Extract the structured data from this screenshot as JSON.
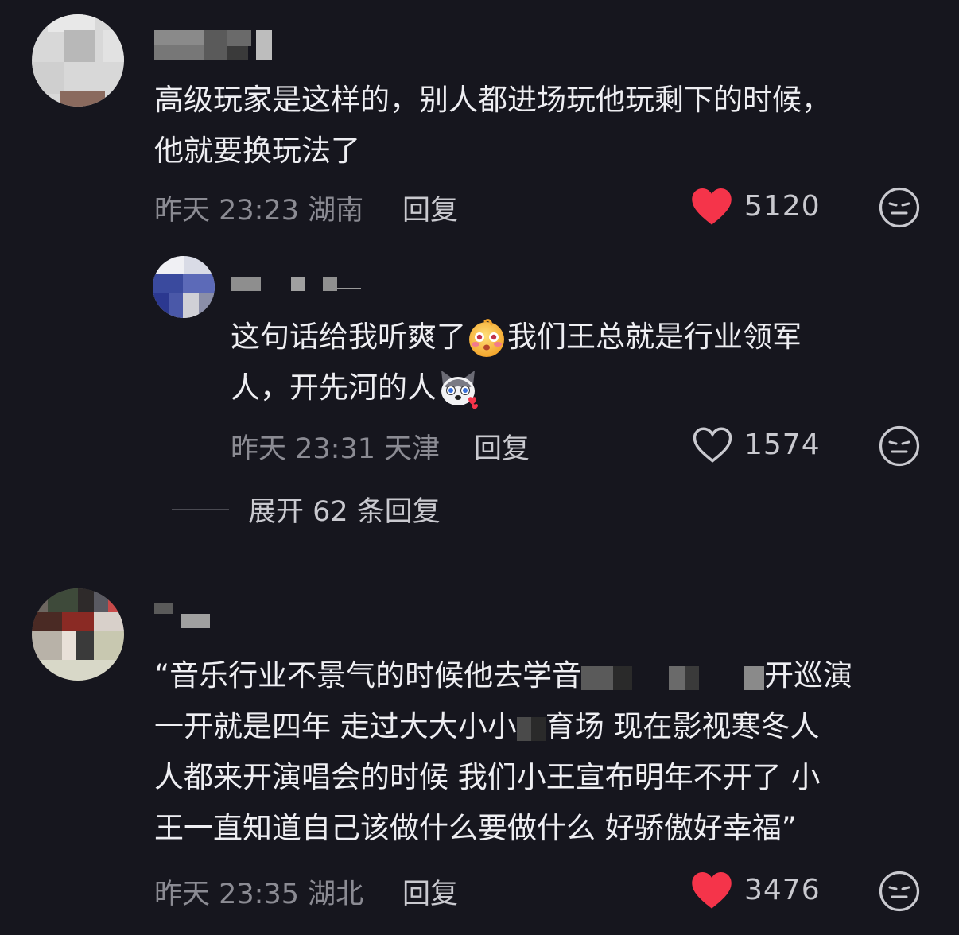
{
  "comments": [
    {
      "text_line1": "高级玩家是这样的，别人都进场玩他玩剩下的时候，",
      "text_line2": "他就要换玩法了",
      "time": "昨天 23:23 湖南",
      "reply_label": "回复",
      "likes": "5120",
      "liked": true
    },
    {
      "text_line1_a": "这句话给我听爽了",
      "text_line1_b": "我们王总就是行业领军",
      "text_line2": "人，开先河的人",
      "time": "昨天 23:31 天津",
      "reply_label": "回复",
      "likes": "1574",
      "liked": false
    },
    {
      "text_line1_a": "“音乐行业不景气的时候他去学音",
      "text_line1_b": "开巡演",
      "text_line2_a": "一开就是四年 走过大大小小",
      "text_line2_b": "育场 现在影视寒冬人",
      "text_line3": "人都来开演唱会的时候 我们小王宣布明年不开了 小",
      "text_line4": "王一直知道自己该做什么要做什么 好骄傲好幸福”",
      "time": "昨天 23:35 湖北",
      "reply_label": "回复",
      "likes": "3476",
      "liked": true
    }
  ],
  "expand_replies": "展开 62 条回复",
  "colors": {
    "background": "#16161e",
    "heart_red": "#f5344a",
    "meta_gray": "#8b8b93"
  },
  "icons": [
    "heart-filled-icon",
    "heart-outline-icon",
    "neutral-face-icon",
    "emoji-blush-face",
    "emoji-husky-dog"
  ]
}
